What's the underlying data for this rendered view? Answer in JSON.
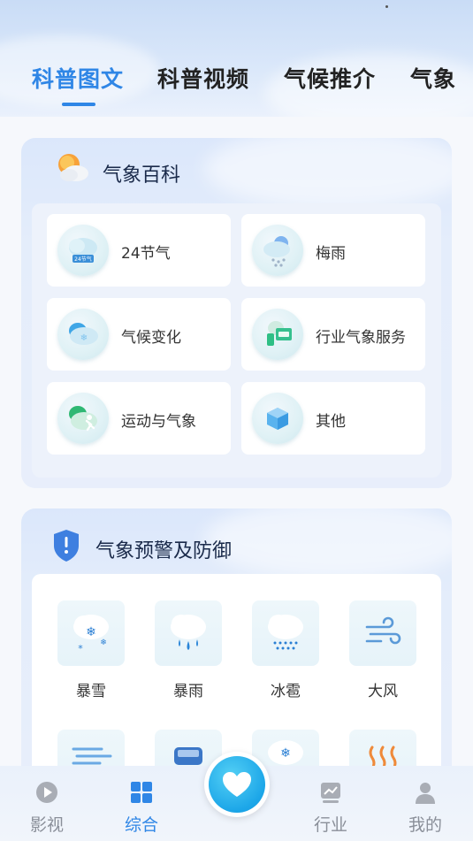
{
  "header": {
    "tabs": [
      {
        "label": "科普图文",
        "active": true
      },
      {
        "label": "科普视频",
        "active": false
      },
      {
        "label": "气候推介",
        "active": false
      },
      {
        "label": "气象",
        "active": false
      }
    ]
  },
  "encyclopedia": {
    "title": "气象百科",
    "items": [
      {
        "label": "24节气",
        "icon": "solar-terms-icon"
      },
      {
        "label": "梅雨",
        "icon": "plum-rain-icon"
      },
      {
        "label": "气候变化",
        "icon": "climate-change-icon"
      },
      {
        "label": "行业气象服务",
        "icon": "industry-service-icon"
      },
      {
        "label": "运动与气象",
        "icon": "sports-weather-icon"
      },
      {
        "label": "其他",
        "icon": "other-icon"
      }
    ],
    "badge_text": "24节气"
  },
  "warnings": {
    "title": "气象预警及防御",
    "items": [
      {
        "label": "暴雪",
        "icon": "snowstorm-icon"
      },
      {
        "label": "暴雨",
        "icon": "rainstorm-icon"
      },
      {
        "label": "冰雹",
        "icon": "hail-icon"
      },
      {
        "label": "大风",
        "icon": "gale-icon"
      },
      {
        "label": "",
        "icon": "fog-icon"
      },
      {
        "label": "",
        "icon": "road-icing-icon"
      },
      {
        "label": "",
        "icon": "cold-wave-icon"
      },
      {
        "label": "",
        "icon": "heat-wave-icon"
      }
    ]
  },
  "bottom_nav": [
    {
      "label": "影视",
      "icon": "play-icon",
      "active": false
    },
    {
      "label": "综合",
      "icon": "grid-icon",
      "active": true
    },
    {
      "label": "行业",
      "icon": "chart-icon",
      "active": false
    },
    {
      "label": "我的",
      "icon": "user-icon",
      "active": false
    }
  ],
  "colors": {
    "accent": "#2f86e6",
    "center_button": "#1ca6e8"
  }
}
